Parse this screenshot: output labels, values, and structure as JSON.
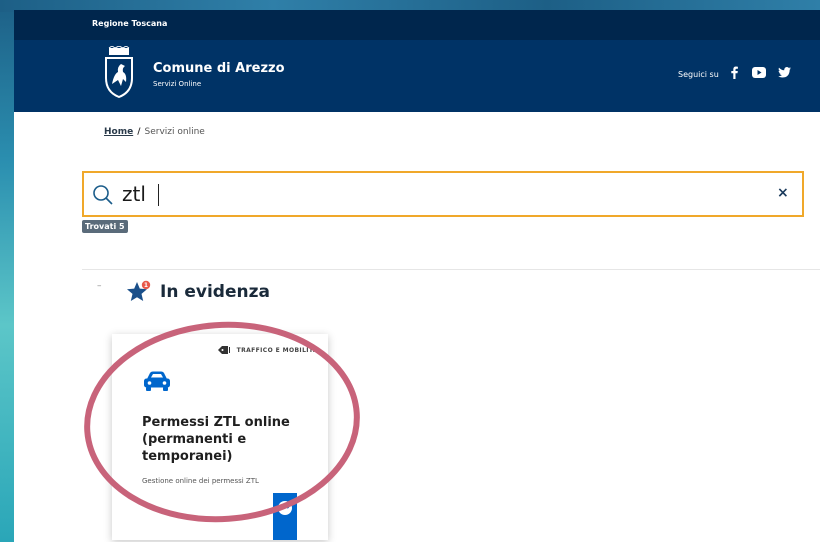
{
  "top_bar": {
    "region": "Regione Toscana"
  },
  "header": {
    "title": "Comune di Arezzo",
    "subtitle": "Servizi Online",
    "follow_label": "Seguici su",
    "social_icons": [
      "facebook-icon",
      "youtube-icon",
      "twitter-icon"
    ]
  },
  "breadcrumb": {
    "home": "Home",
    "separator": "/",
    "current": "Servizi online"
  },
  "search": {
    "value": "ztl",
    "clear_label": "×",
    "results_count": "Trovati 5"
  },
  "section": {
    "title": "In evidenza",
    "dash": "–",
    "badge_count": "1"
  },
  "cards": [
    {
      "category": "TRAFFICO E MOBILITÀ",
      "title": "Permessi ZTL online (permanenti e temporanei)",
      "description": "Gestione online dei permessi ZTL"
    }
  ],
  "colors": {
    "header_bg": "#003366",
    "topbar_bg": "#00264d",
    "search_border": "#f0a82a",
    "accent_blue": "#0066cc",
    "annotation": "#c8637a"
  }
}
